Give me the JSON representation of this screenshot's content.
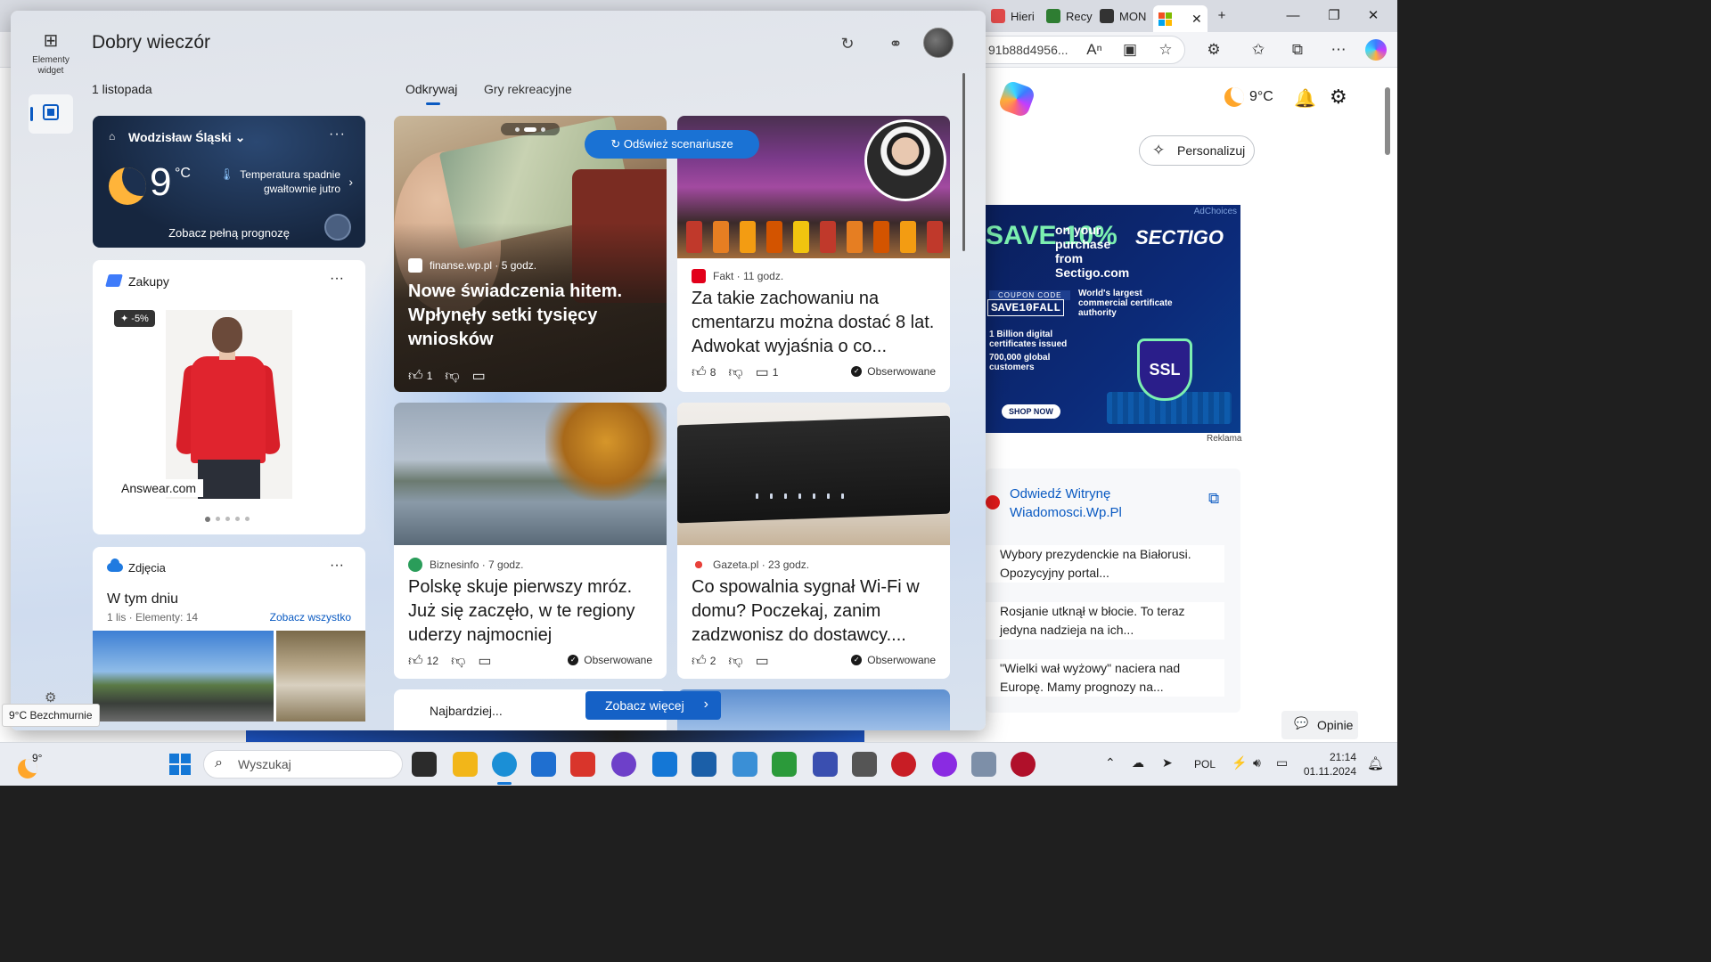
{
  "browser": {
    "tabs": [
      {
        "label": "Hieri",
        "color": "#e04a4a"
      },
      {
        "label": "Recy",
        "color": "#2e7d32"
      },
      {
        "label": "MON",
        "color": "#333333"
      }
    ],
    "active_tab_color": "#f25022",
    "url": "91b88d4956...",
    "window": {
      "minimize": "—",
      "maximize": "❐",
      "close": "✕"
    },
    "page": {
      "weather_temp": "9°C",
      "personalize_label": "Personalizuj",
      "ad": {
        "adchoices": "AdChoices",
        "save": "SAVE 10%",
        "purchase": "on your purchase from Sectigo.com",
        "brand": "SECTIGO",
        "code_label": "COUPON CODE",
        "code": "SAVE10FALL",
        "claim": "World's largest commercial certificate authority",
        "stat1": "1 Billion digital certificates issued",
        "stat2": "700,000 global customers",
        "cta": "SHOP NOW",
        "badge": "SSL"
      },
      "ad_label": "Reklama",
      "wp": {
        "title": "Odwiedź Witrynę Wiadomosci.Wp.Pl",
        "items": [
          "Wybory prezydenckie na Białorusi. Opozycyjny portal...",
          "Rosjanie utknął w błocie. To teraz jedyna nadzieja na ich...",
          "\"Wielki wał wyżowy\" naciera nad Europę. Mamy prognozy na..."
        ]
      },
      "feedback_label": "Opinie"
    }
  },
  "panel": {
    "rail_widgets_label": "Elementy widget",
    "greeting": "Dobry wieczór",
    "date": "1 listopada",
    "tabs": [
      {
        "label": "Odkrywaj"
      },
      {
        "label": "Gry rekreacyjne"
      }
    ],
    "weather": {
      "location": "Wodzisław Śląski",
      "temp": "9",
      "unit": "°C",
      "alert": "Temperatura spadnie gwałtownie jutro",
      "forecast_link": "Zobacz pełną prognozę"
    },
    "shopping": {
      "title": "Zakupy",
      "discount": "-5%",
      "brand": "Answear.com",
      "pages": 5,
      "active_page": 1
    },
    "photos": {
      "title": "Zdjęcia",
      "heading": "W tym dniu",
      "meta": "1 lis · Elementy: 14",
      "see_all": "Zobacz wszystko"
    },
    "refresh_label": "Odśwież scenariusze",
    "see_more_label": "Zobacz więcej",
    "news": [
      {
        "source": "finanse.wp.pl",
        "age": "5 godz.",
        "headline": "Nowe świadczenia hitem. Wpłynęły setki tysięcy wniosków",
        "likes": "1",
        "comments": ""
      },
      {
        "source": "Fakt",
        "age": "11 godz.",
        "headline": "Za takie zachowaniu na cmentarzu można dostać 8 lat. Adwokat wyjaśnia o co...",
        "likes": "8",
        "comments": "1",
        "follow": "Obserwowane"
      },
      {
        "source": "Biznesinfo",
        "age": "7 godz.",
        "headline": "Polskę skuje pierwszy mróz. Już się zaczęło, w te regiony uderzy najmocniej",
        "likes": "12",
        "comments": "",
        "follow": "Obserwowane"
      },
      {
        "source": "Gazeta.pl",
        "age": "23 godz.",
        "headline": "Co spowalnia sygnał Wi-Fi w domu? Poczekaj, zanim zadzwonisz do dostawcy....",
        "likes": "2",
        "comments": "",
        "follow": "Obserwowane"
      }
    ],
    "peek_text": "Najbardziej..."
  },
  "tooltip": "9°C Bezchmurnie",
  "taskbar": {
    "weather_temp": "9°",
    "search_placeholder": "Wyszukaj",
    "lang": "POL",
    "time": "21:14",
    "date": "01.11.2024",
    "apps": [
      {
        "name": "task-view",
        "color": "#2b2b2b"
      },
      {
        "name": "file-explorer",
        "color": "#f2b619"
      },
      {
        "name": "edge",
        "color": "#1b8fd6"
      },
      {
        "name": "store",
        "color": "#1f6fd0"
      },
      {
        "name": "pdf-app",
        "color": "#d9352b"
      },
      {
        "name": "github",
        "color": "#6e40c9"
      },
      {
        "name": "azure-tool",
        "color": "#1477d6"
      },
      {
        "name": "virtualbox",
        "color": "#1b5fa8"
      },
      {
        "name": "remote-desktop",
        "color": "#3a8fd6"
      },
      {
        "name": "globe-app",
        "color": "#2b9a3a"
      },
      {
        "name": "save-app",
        "color": "#3a4fb0"
      },
      {
        "name": "usb-app",
        "color": "#555555"
      },
      {
        "name": "red-app",
        "color": "#c81d25"
      },
      {
        "name": "purple-app",
        "color": "#8a2be2"
      },
      {
        "name": "scanner-app",
        "color": "#7d8fa8"
      },
      {
        "name": "dashlane-app",
        "color": "#b0102a"
      }
    ]
  }
}
